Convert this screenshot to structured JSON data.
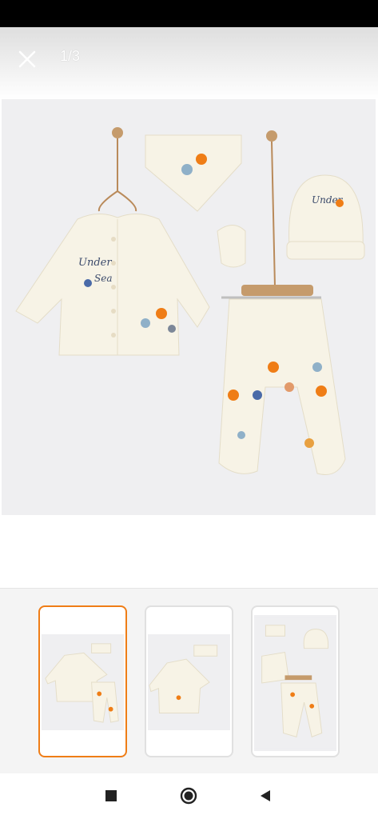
{
  "viewer": {
    "counter": "1/3",
    "close_icon": "close-icon"
  },
  "product_image": {
    "print_text": "Under the Sea"
  },
  "thumbnails": [
    {
      "label": "image-1",
      "selected": true
    },
    {
      "label": "image-2",
      "selected": false
    },
    {
      "label": "image-3",
      "selected": false
    }
  ],
  "colors": {
    "accent": "#ef7d16",
    "photo_background": "#efeff1",
    "garment": "#f7f3e6"
  },
  "nav": {
    "recents_icon": "square-icon",
    "home_icon": "circle-icon",
    "back_icon": "triangle-back-icon"
  }
}
